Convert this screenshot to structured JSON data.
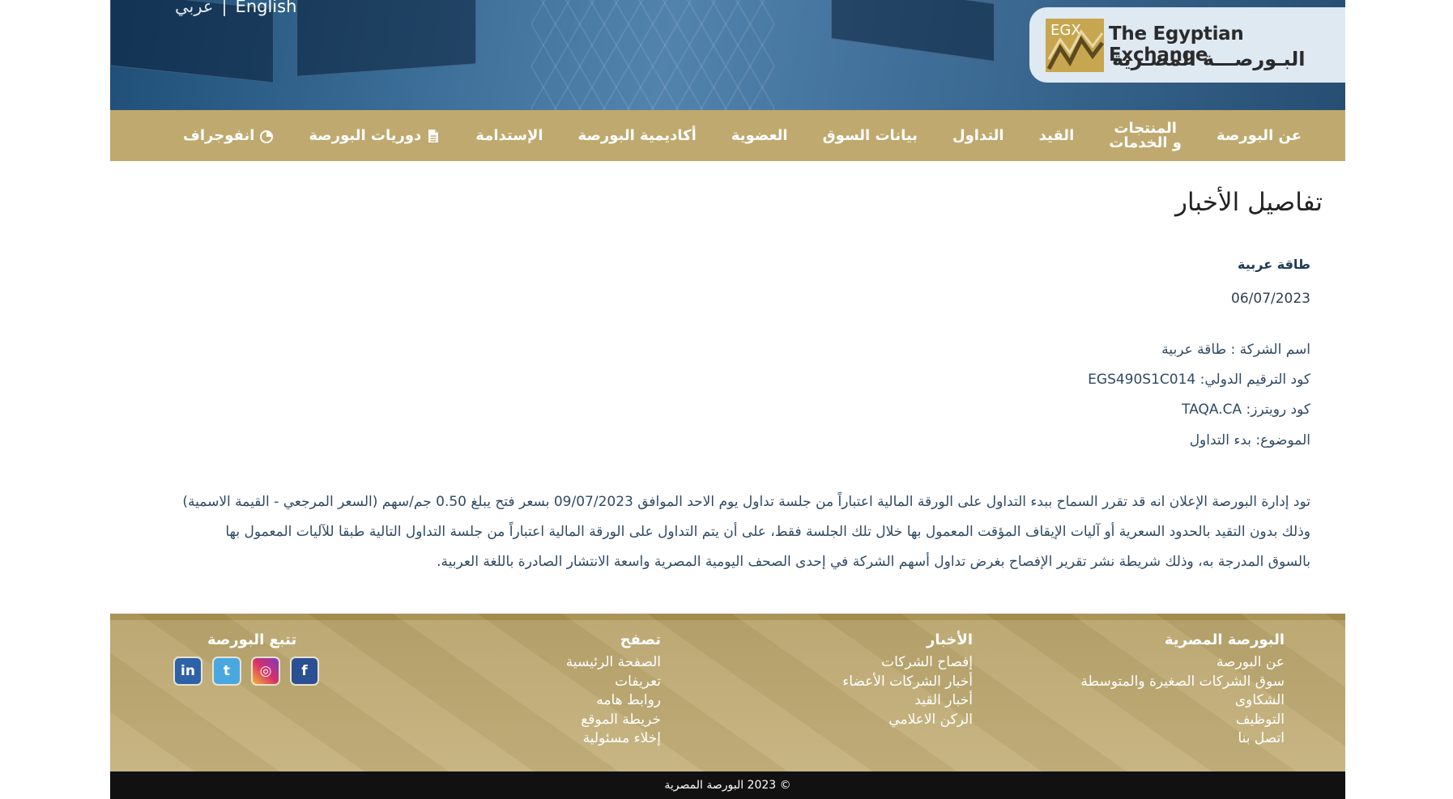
{
  "header": {
    "lang_ar": "عربي",
    "lang_sep": "|",
    "lang_en": "English",
    "logo_mark": "EGX",
    "logo_en": "The Egyptian Exchange",
    "logo_ar": "البـورصـــة المصـرية"
  },
  "nav": {
    "items": [
      {
        "label": "عن البورصة"
      },
      {
        "label_line1": "المنتجات",
        "label_line2": "و الخدمات"
      },
      {
        "label": "القيد"
      },
      {
        "label": "التداول"
      },
      {
        "label": "بيانات السوق"
      },
      {
        "label": "العضوية"
      },
      {
        "label": "أكاديمية البورصة"
      },
      {
        "label": "الإستدامة"
      },
      {
        "label": "دوريات البورصة",
        "icon": "document-icon"
      },
      {
        "label": "انفوجراف",
        "icon": "pie-chart-icon"
      }
    ]
  },
  "content": {
    "title": "تفاصيل الأخبار",
    "company_bold": "طاقة عربية",
    "date": "06/07/2023",
    "meta": [
      "اسم الشركة : طاقة عربية",
      "كود الترقيم الدولي: EGS490S1C014",
      "كود رويترز: TAQA.CA",
      "الموضوع: بدء التداول"
    ],
    "body": [
      "تود إدارة البورصة الإعلان انه قد تقرر السماح ببدء التداول على الورقة المالية اعتباراً من جلسة تداول يوم الاحد الموافق 09/07/2023 بسعر فتح يبلغ 0.50 جم/سهم (السعر المرجعي - القيمة الاسمية)",
      "وذلك بدون التقيد بالحدود السعرية أو آليات الإيقاف المؤقت المعمول بها خلال تلك الجلسة فقط، على أن يتم التداول على الورقة المالية اعتباراً من جلسة التداول التالية طبقا للآليات المعمول بها",
      "بالسوق المدرجة به، وذلك شريطة نشر تقرير الإفصاح بغرض تداول أسهم الشركة في إحدى الصحف اليومية المصرية واسعة الانتشار الصادرة باللغة العربية."
    ]
  },
  "footer": {
    "col1": {
      "title": "البورصة المصرية",
      "links": [
        "عن البورصة",
        "سوق الشركات الصغيرة والمتوسطة",
        "الشكاوى",
        "التوظيف",
        "اتصل بنا"
      ]
    },
    "col2": {
      "title": "الأخبار",
      "links": [
        "إفصاح الشركات",
        "أخبار الشركات الأعضاء",
        "أخبار القيد",
        "الركن الاعلامي"
      ]
    },
    "col3": {
      "title": "تصفح",
      "links": [
        "الصفحة الرئيسية",
        "تعريفات",
        "روابط هامه",
        "خريطة الموقع",
        "إخلاء مسئولية"
      ]
    },
    "social_title": "تتبع البورصة",
    "socials": [
      {
        "name": "linkedin-icon",
        "glyph": "in",
        "color": "#2e62a8"
      },
      {
        "name": "twitter-icon",
        "glyph": "t",
        "color": "#4aa8e0"
      },
      {
        "name": "instagram-icon",
        "glyph": "◎",
        "color": "#d6306a"
      },
      {
        "name": "facebook-icon",
        "glyph": "f",
        "color": "#2b4f93"
      }
    ],
    "copyright": "© 2023 البورصة المصرية"
  },
  "colors": {
    "nav_bg": "#bfa96e",
    "footer_bg": "#c4b17c",
    "banner": "#3a6d97"
  }
}
